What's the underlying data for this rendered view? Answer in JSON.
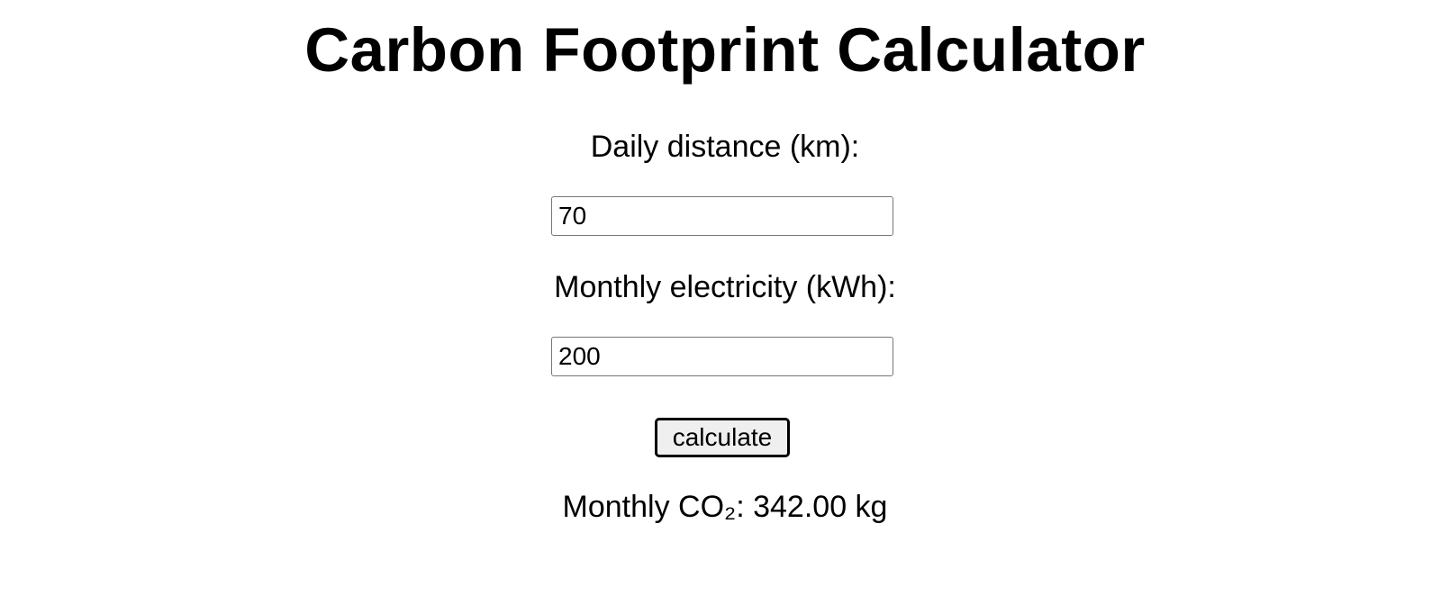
{
  "header": {
    "title": "Carbon Footprint Calculator"
  },
  "form": {
    "distance_label": "Daily distance (km):",
    "distance_value": "70",
    "electricity_label": "Monthly electricity (kWh):",
    "electricity_value": "200",
    "calculate_label": "calculate"
  },
  "result": {
    "text": "Monthly CO₂: 342.00 kg"
  },
  "colors": {
    "text": "#000000",
    "background": "#ffffff",
    "button_background": "#efefef",
    "input_border": "#767676"
  }
}
